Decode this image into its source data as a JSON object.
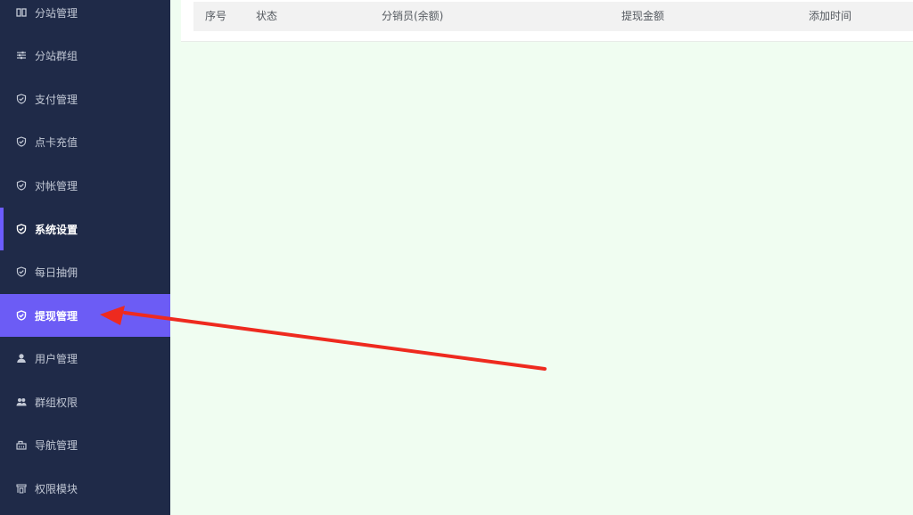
{
  "sidebar": {
    "items": [
      {
        "label": "分站管理",
        "icon": "columns-icon"
      },
      {
        "label": "分站群组",
        "icon": "sliders-icon"
      },
      {
        "label": "支付管理",
        "icon": "shield-check-icon"
      },
      {
        "label": "点卡充值",
        "icon": "shield-check-icon"
      },
      {
        "label": "对帐管理",
        "icon": "shield-check-icon"
      },
      {
        "label": "系统设置",
        "icon": "shield-check-icon"
      },
      {
        "label": "每日抽佣",
        "icon": "shield-check-icon"
      },
      {
        "label": "提现管理",
        "icon": "shield-check-icon"
      },
      {
        "label": "用户管理",
        "icon": "user-icon"
      },
      {
        "label": "群组权限",
        "icon": "users-icon"
      },
      {
        "label": "导航管理",
        "icon": "navigation-icon"
      },
      {
        "label": "权限模块",
        "icon": "modules-icon"
      }
    ]
  },
  "table": {
    "headers": [
      "序号",
      "状态",
      "分销员(余额)",
      "提现金额",
      "添加时间"
    ]
  },
  "colors": {
    "sidebar_bg": "#1f2a48",
    "active_bg": "#6c5cf5",
    "content_bg": "#f0fdf1",
    "annotation_arrow": "#ee2a1f"
  }
}
